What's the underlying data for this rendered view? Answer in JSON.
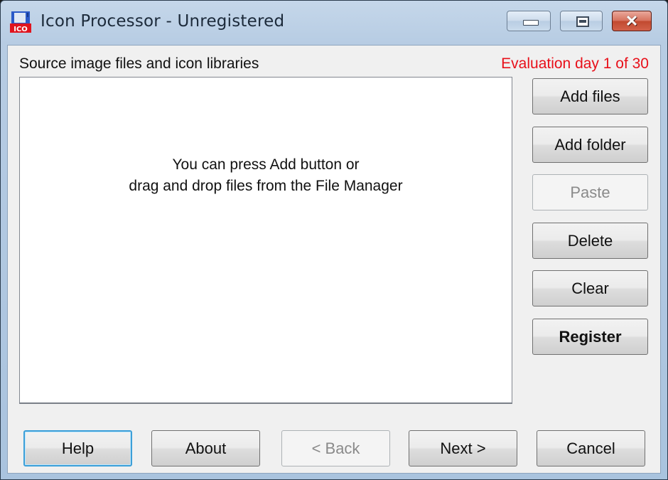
{
  "window": {
    "title": "Icon Processor - Unregistered",
    "app_icon_text": "ICO",
    "controls": {
      "minimize": "minimize",
      "maximize": "maximize",
      "close": "✕"
    }
  },
  "main": {
    "source_label": "Source image files and icon libraries",
    "evaluation_status": "Evaluation day 1 of 30",
    "evaluation_color": "#e8101a",
    "list_hint_line1": "You can press Add button or",
    "list_hint_line2": "drag and drop files from the File Manager"
  },
  "side_buttons": [
    {
      "label": "Add files",
      "enabled": true
    },
    {
      "label": "Add folder",
      "enabled": true
    },
    {
      "label": "Paste",
      "enabled": false
    },
    {
      "label": "Delete",
      "enabled": true
    },
    {
      "label": "Clear",
      "enabled": true
    },
    {
      "label": "Register",
      "enabled": true,
      "bold": true
    }
  ],
  "bottom_buttons": [
    {
      "label": "Help",
      "enabled": true,
      "focused": true
    },
    {
      "label": "About",
      "enabled": true
    },
    {
      "label": "< Back",
      "enabled": false
    },
    {
      "label": "Next >",
      "enabled": true
    },
    {
      "label": "Cancel",
      "enabled": true
    }
  ]
}
